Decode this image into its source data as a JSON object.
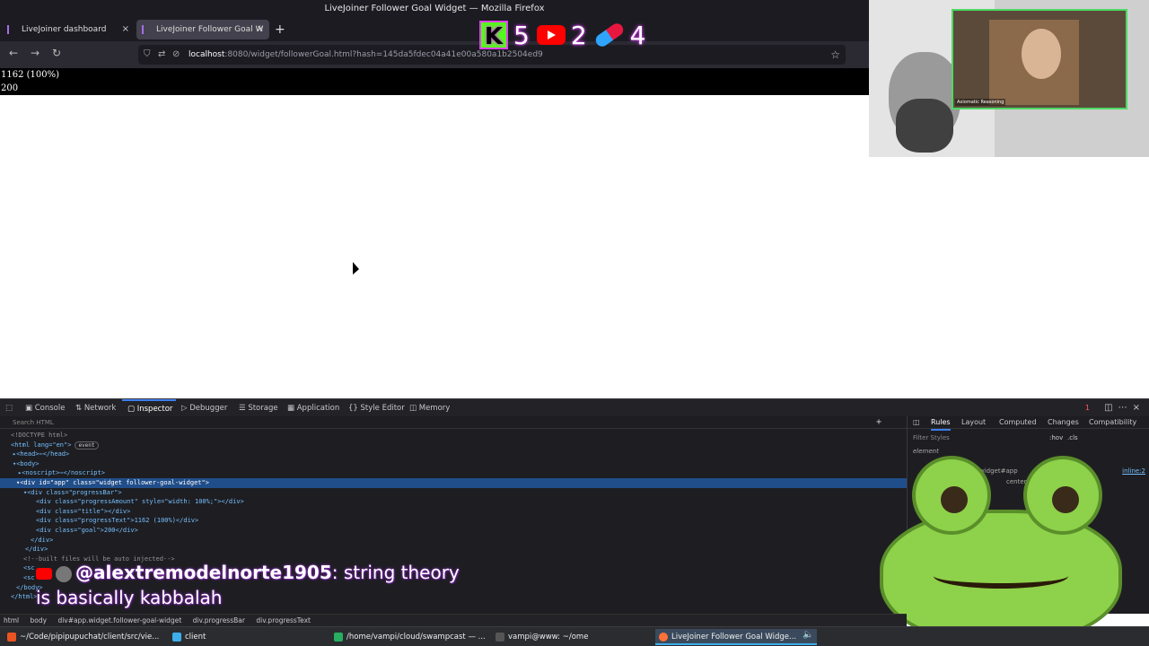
{
  "window": {
    "title": "LiveJoiner Follower Goal Widget — Mozilla Firefox"
  },
  "tabs": [
    {
      "label": "LiveJoiner dashboard",
      "close": "×"
    },
    {
      "label": "LiveJoiner Follower Goal W",
      "close": "×"
    }
  ],
  "new_tab": "+",
  "url": {
    "host": "localhost",
    "rest": ":8080/widget/followerGoal.html?hash=145da5fdec04a41e00a580a1b2504ed9"
  },
  "counters": {
    "kick_glyph": "K",
    "kick": "5",
    "youtube": "2",
    "pill": "4"
  },
  "webcam": {
    "name_tag": "Axiomatic Reasoning"
  },
  "widget": {
    "progress_text": "1162 (100%)",
    "goal": "200"
  },
  "devtools": {
    "tabs": [
      "Console",
      "Network",
      "Inspector",
      "Debugger",
      "Storage",
      "Application",
      "Style Editor",
      "Memory"
    ],
    "search_placeholder": "Search HTML",
    "error_count": "1",
    "rules_tabs": [
      "Rules",
      "Layout",
      "Computed",
      "Changes",
      "Compatibility"
    ],
    "filter_placeholder": "Filter Styles",
    "hov": ":hov",
    "cls": ".cls",
    "element_rule": "element",
    "inline_link": "inline:2",
    "rule_selector": "widget#app",
    "rule_value": "center",
    "dom": [
      {
        "text": "<!DOCTYPE html>",
        "cls": "cm"
      },
      {
        "text": "<html lang=\"en\">",
        "cls": "tg",
        "badge": "event"
      },
      {
        "text": "▸<head>⋯</head>",
        "cls": "tg"
      },
      {
        "text": "▾<body>",
        "cls": "tg"
      },
      {
        "text": "▸<noscript>⋯</noscript>",
        "cls": "tg"
      },
      {
        "text": "▾<div id=\"app\" class=\"widget follower-goal-widget\">",
        "cls": "tg",
        "selected": true
      },
      {
        "text": "▾<div class=\"progressBar\">",
        "cls": "tg"
      },
      {
        "text": "<div class=\"progressAmount\" style=\"width: 100%;\"></div>",
        "cls": "tg"
      },
      {
        "text": "<div class=\"title\"></div>",
        "cls": "tg"
      },
      {
        "text": "<div class=\"progressText\">1162 (100%)</div>",
        "cls": "tg"
      },
      {
        "text": "<div class=\"goal\">200</div>",
        "cls": "tg"
      },
      {
        "text": "</div>",
        "cls": "tg"
      },
      {
        "text": "</div>",
        "cls": "tg"
      },
      {
        "text": "<!--built files will be auto injected-->",
        "cls": "cm"
      },
      {
        "text": "<sc",
        "cls": "tg"
      },
      {
        "text": "<sc",
        "cls": "tg"
      },
      {
        "text": "</body>",
        "cls": "tg"
      },
      {
        "text": "</html>",
        "cls": "tg"
      }
    ],
    "breadcrumbs": [
      "html",
      "body",
      "div#app.widget.follower-goal-widget",
      "div.progressBar",
      "div.progressText"
    ]
  },
  "chat": {
    "user": "@alextremodelnorte1905",
    "message_line1": ": string theory",
    "message_line2": "is basically kabbalah"
  },
  "taskbar": [
    {
      "label": "~/Code/pipipupuchat/client/src/vie...",
      "icon_color": "#e95420"
    },
    {
      "label": "client",
      "icon_color": "#3daee9"
    },
    {
      "label": "/home/vampi/cloud/swampcast — ...",
      "icon_color": "#27ae60"
    },
    {
      "label": "vampi@www: ~/ome",
      "icon_color": "#31363b"
    },
    {
      "label": "LiveJoiner Follower Goal Widge...",
      "icon_color": "#ff7139"
    }
  ],
  "colors": {
    "accent": "#3c7ef0",
    "kick": "#53fc18",
    "youtube": "#ff0000",
    "frog": "#8ed14a"
  }
}
